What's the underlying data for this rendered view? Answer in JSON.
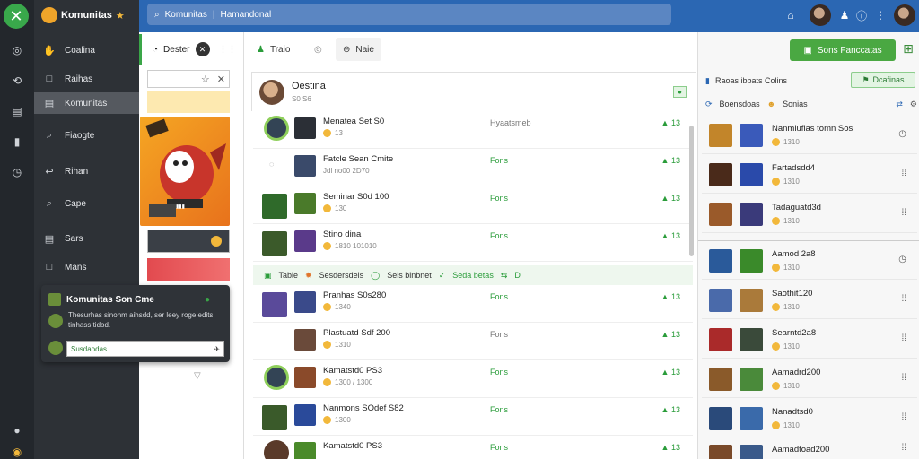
{
  "rail": {
    "icons": [
      "app-logo-x-icon",
      "compass-icon",
      "clock-icon",
      "inbox-icon",
      "book-icon",
      "timer-icon",
      "help-icon",
      "coin-icon"
    ]
  },
  "nav": {
    "brand": "Komunitas",
    "items": [
      {
        "label": "Coalina",
        "icon": "hand-icon"
      },
      {
        "label": "Raihas",
        "icon": "square-icon"
      },
      {
        "label": "Komunitas",
        "icon": "list-icon",
        "active": true
      },
      {
        "label": "Fiaogte",
        "icon": "search-icon"
      },
      {
        "label": "Rihan",
        "icon": "back-icon"
      },
      {
        "label": "Cape",
        "icon": "search-icon"
      },
      {
        "label": "Sars",
        "icon": "list-icon"
      },
      {
        "label": "Mans",
        "icon": "square-icon"
      }
    ]
  },
  "topbar": {
    "search_text": "Komunitas",
    "search_text2": "Hamandonal"
  },
  "panelA": {
    "header": "Dester"
  },
  "popup": {
    "title": "Komunitas Son Cme",
    "desc": "Thesurhas sinonm aihsdd, ser leey roge edits tinhass tidod.",
    "input_text": "Susdaodas"
  },
  "main": {
    "tabs": [
      {
        "label": "Traio",
        "icon": "users-icon"
      },
      {
        "label": "Naie",
        "icon": "lock-icon"
      }
    ],
    "header_title": "Oestina",
    "header_sub": "S0 S6",
    "filter_bar": {
      "label": "Tabie",
      "items": [
        "Sesdersdels",
        "Sels binbnet",
        "Seda betas"
      ],
      "count": "D"
    },
    "rows": [
      {
        "name": "Menatea Set S0",
        "sub": "13",
        "col2": "Hyaatsmeb",
        "col2_gray": true,
        "act": "13"
      },
      {
        "name": "Fatcle Sean Cmite",
        "sub": "Jdl no00 2D70",
        "col2": "Fons",
        "act": "13"
      },
      {
        "name": "Seminar S0d 100",
        "sub": "130",
        "col2": "Fons",
        "act": "13"
      },
      {
        "name": "Stino dina",
        "sub": "1810 101010",
        "col2": "Fons",
        "act": "13"
      },
      {
        "name": "Pranhas S0s280",
        "sub": "1340",
        "col2": "Fons",
        "act": "13"
      },
      {
        "name": "Plastuatd Sdf 200",
        "sub": "1310",
        "col2": "Fons",
        "col2_gray": true,
        "act": "13"
      },
      {
        "name": "Kamatstd0 PS3",
        "sub": "1300 / 1300",
        "col2": "Fons",
        "act": "13"
      },
      {
        "name": "Nanmons SOdef S82",
        "sub": "1300",
        "col2": "Fons",
        "act": "13"
      },
      {
        "name": "Kamatstd0 PS3",
        "sub": "1300",
        "col2": "Fons",
        "act": "13"
      }
    ]
  },
  "right": {
    "top_button": "Sons Fanccatas",
    "head_label": "Raoas ibbats Colins",
    "head_btn": "Dcafinas",
    "sub_label": "Boensdoas",
    "sub_label2": "Sonias",
    "rows": [
      {
        "name": "Nanmiuflas tomn Sos",
        "sub": "1310"
      },
      {
        "name": "Fartadsdd4",
        "sub": "1310"
      },
      {
        "name": "Tadaguatd3d",
        "sub": "1310"
      },
      {
        "name": "Aamod 2a8",
        "sub": "1310"
      },
      {
        "name": "Saothit120",
        "sub": "1310"
      },
      {
        "name": "Searntd2a8",
        "sub": "1310"
      },
      {
        "name": "Aamadrd200",
        "sub": "1310"
      },
      {
        "name": "Nanadtsd0",
        "sub": "1310"
      },
      {
        "name": "Aamadtoad200",
        "sub": "1310"
      }
    ]
  },
  "colors": {
    "rail": "#23272c",
    "nav": "#2d3136",
    "topbar": "#2b67b3",
    "accent_green": "#4aa842"
  }
}
